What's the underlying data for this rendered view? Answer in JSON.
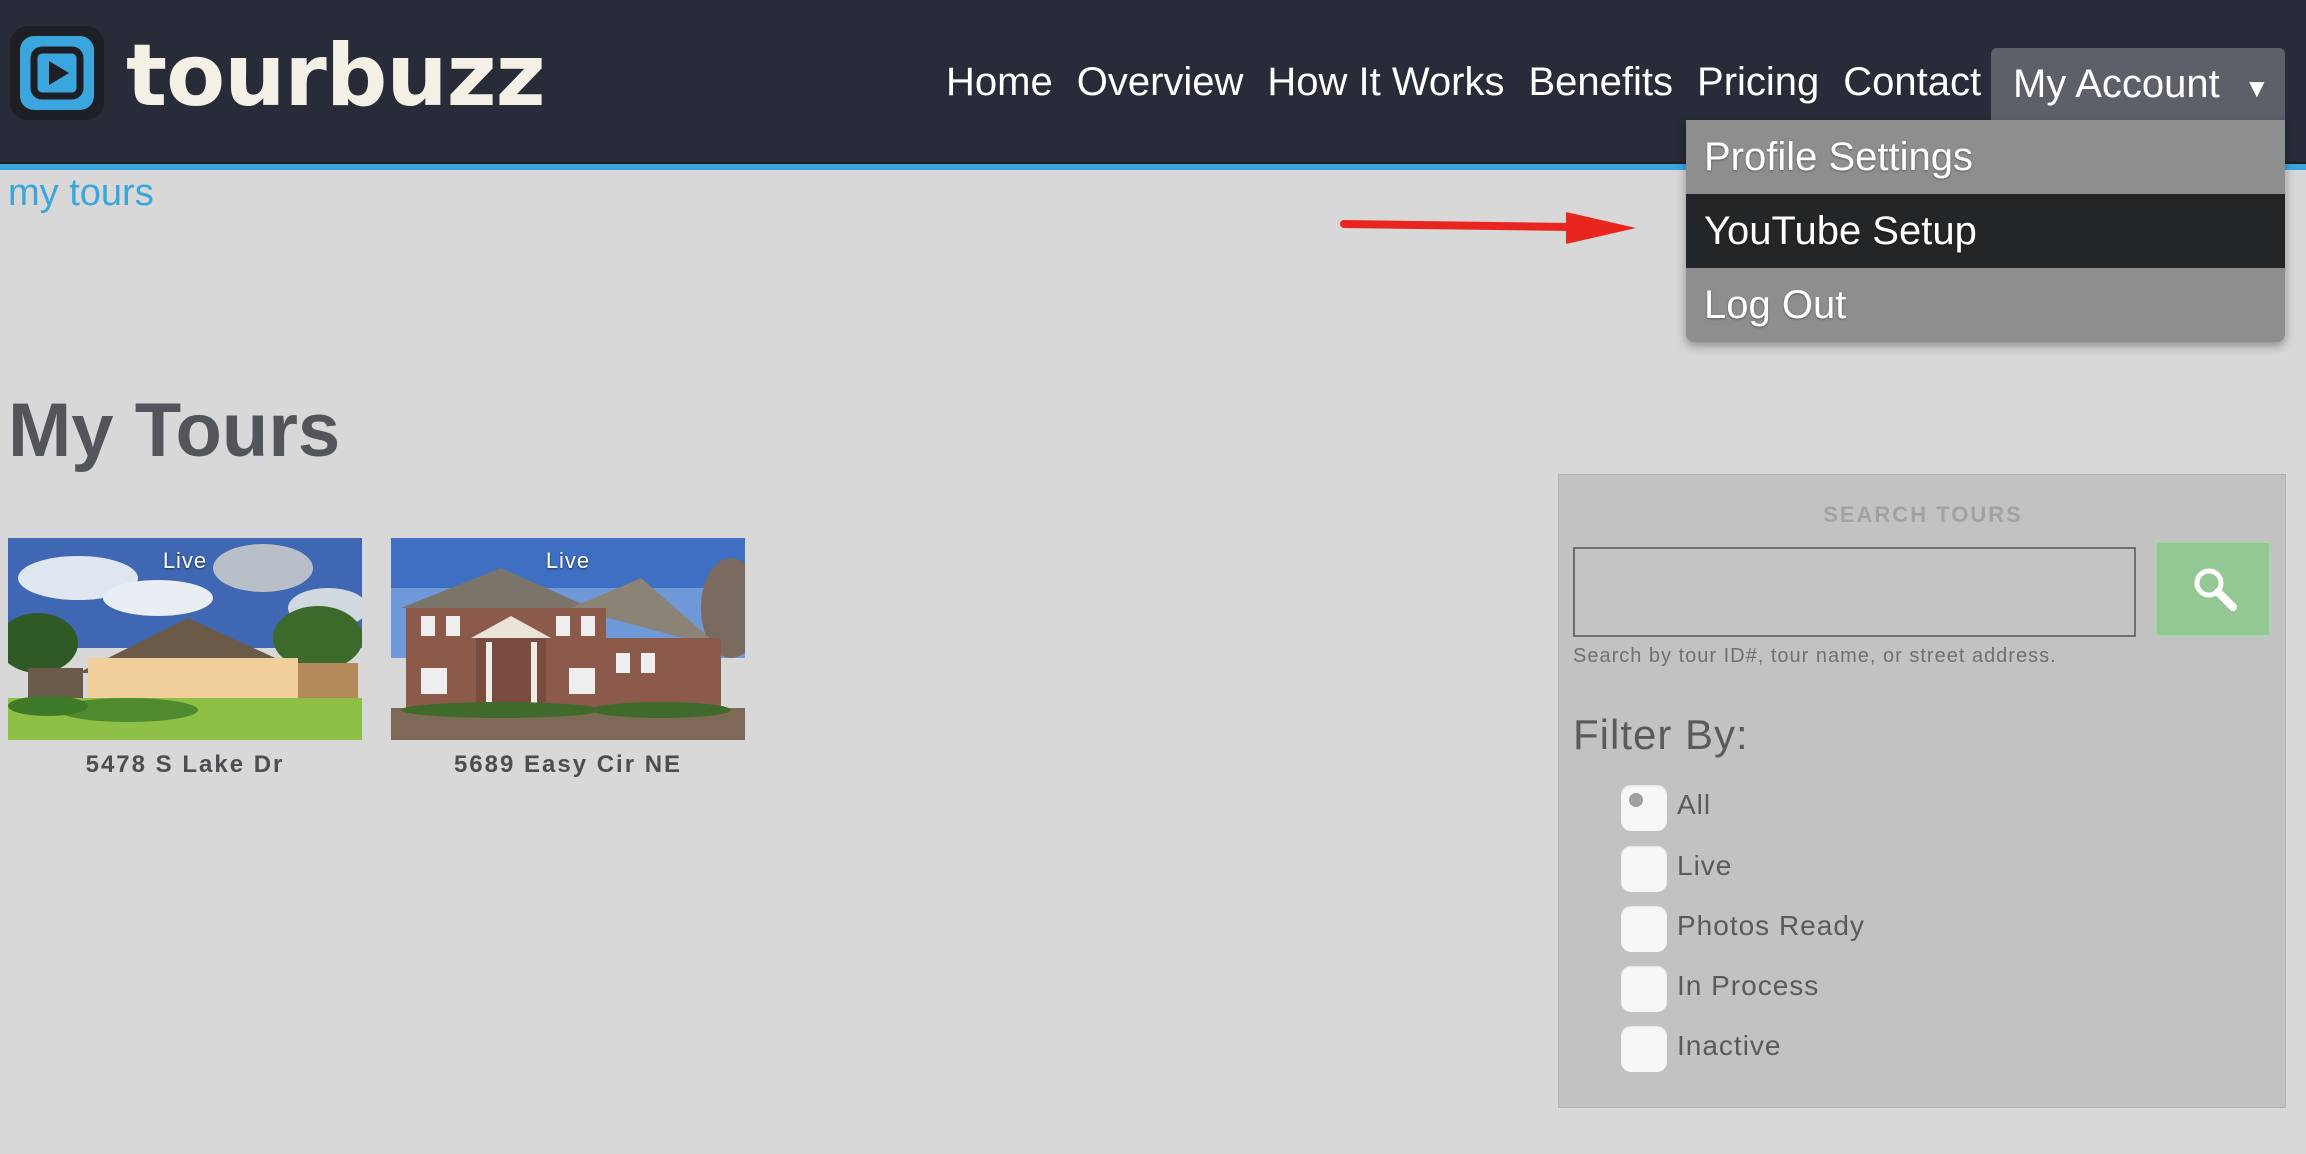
{
  "header": {
    "brand": "tourbuzz",
    "nav": [
      "Home",
      "Overview",
      "How It Works",
      "Benefits",
      "Pricing",
      "Contact"
    ],
    "account_label": "My Account",
    "account_caret": "▼",
    "subnav": "my tours"
  },
  "account_menu": {
    "items": [
      "Profile Settings",
      "YouTube Setup",
      "Log Out"
    ],
    "active_item": "YouTube Setup"
  },
  "main": {
    "title": "My Tours",
    "tours": [
      {
        "name": "5478 S Lake Dr",
        "status": "Live"
      },
      {
        "name": "5689 Easy Cir NE",
        "status": "Live"
      }
    ]
  },
  "search": {
    "title": "SEARCH TOURS",
    "input_value": "",
    "hint": "Search by tour ID#, tour name, or street address.",
    "button_icon": "magnifier-icon"
  },
  "filter": {
    "heading": "Filter By:",
    "options": [
      "All",
      "Live",
      "Photos Ready",
      "In Process",
      "Inactive"
    ],
    "selected": "All"
  },
  "colors": {
    "header_bg": "#272c38",
    "accent": "#3aa6dd",
    "menu_active": "#232628",
    "search_button": "#93c794",
    "annotation_arrow": "#e8261f"
  }
}
